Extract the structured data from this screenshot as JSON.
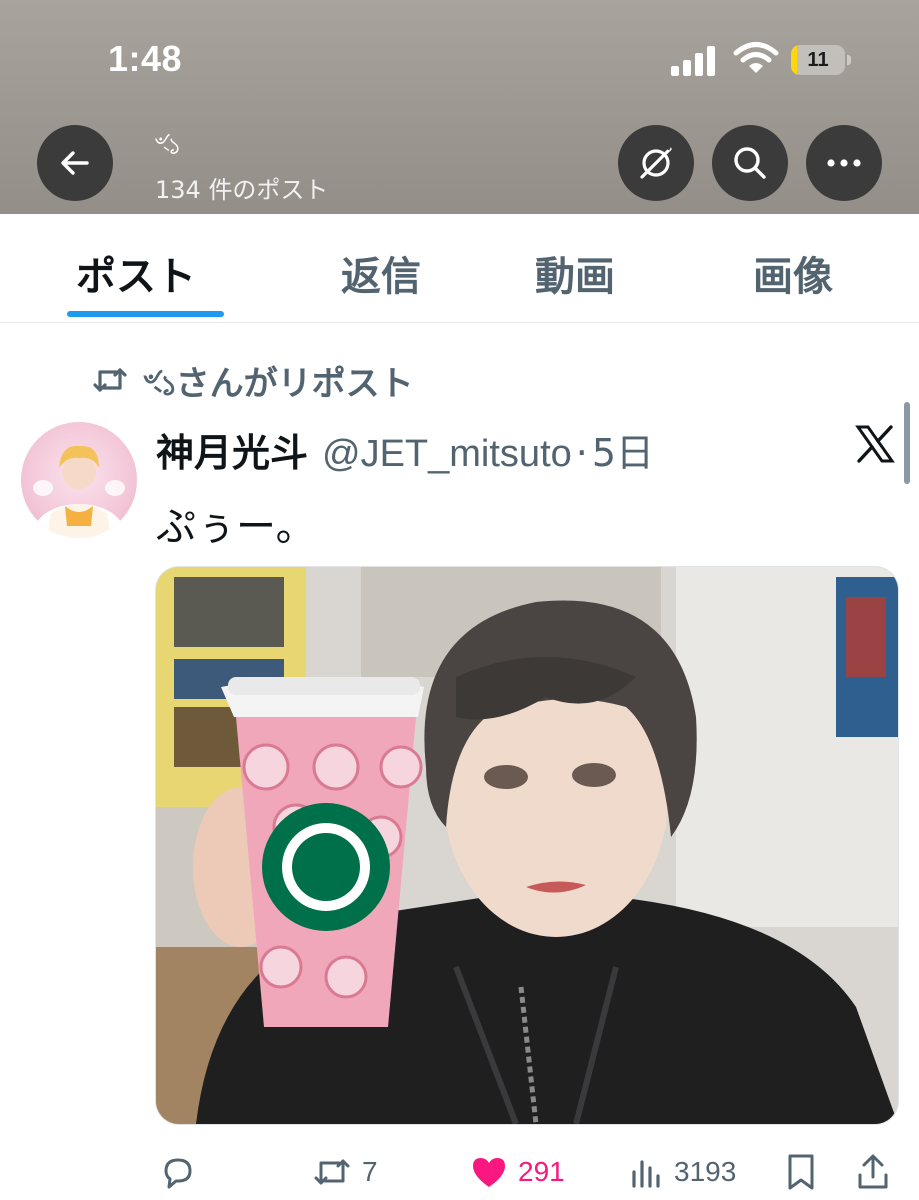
{
  "status_bar": {
    "time": "1:48",
    "battery_level": "11",
    "battery_fraction": 0.11
  },
  "profile_header": {
    "display_name": "ৼ১",
    "post_count": "134 件のポスト",
    "icons": [
      "back-arrow-icon",
      "grok-icon",
      "search-icon",
      "more-icon"
    ]
  },
  "tabs": [
    {
      "label": "ポスト",
      "active": true
    },
    {
      "label": "返信",
      "active": false
    },
    {
      "label": "動画",
      "active": false
    },
    {
      "label": "画像",
      "active": false
    }
  ],
  "post": {
    "repost_label": "ৼ১さんがリポスト",
    "author_name": "神月光斗",
    "author_handle": "@JET_mitsuto",
    "separator": "·",
    "time": "5日",
    "text": "ぷぅー。",
    "actions": {
      "reply_count": "",
      "repost_count": "7",
      "like_count": "291",
      "view_count": "3193"
    }
  },
  "colors": {
    "accent": "#1d9bf0",
    "like": "#f91880",
    "secondary_text": "#536471",
    "primary_text": "#0f1419",
    "header_bg": "#9b9690"
  }
}
